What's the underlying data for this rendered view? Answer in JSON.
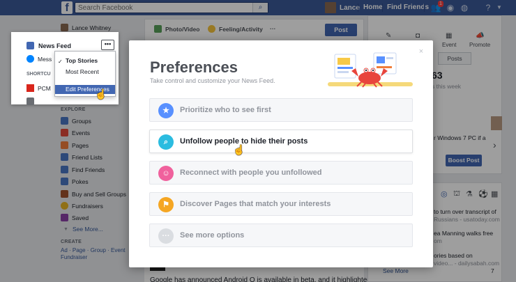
{
  "topbar": {
    "search_placeholder": "Search Facebook",
    "user_name": "Lance",
    "nav_home": "Home",
    "nav_find_friends": "Find Friends",
    "notification_count": "1"
  },
  "left_nav": {
    "user_name": "Lance Whitney",
    "explore_heading": "EXPLORE",
    "explore_items": [
      "Groups",
      "Events",
      "Pages",
      "Friend Lists",
      "Find Friends",
      "Pokes",
      "Buy and Sell Groups",
      "Fundraisers",
      "Saved"
    ],
    "see_more": "See More...",
    "create_heading": "CREATE",
    "create_links_line1": "Ad · Page · Group · Event",
    "create_links_line2": "Fundraiser"
  },
  "composer": {
    "photo_video": "Photo/Video",
    "feeling": "Feeling/Activity",
    "more": "···",
    "post": "Post"
  },
  "feed": {
    "snippet": "Google has announced Android O is available in beta, and it highlighted"
  },
  "right": {
    "tab_event": "Event",
    "tab_promote": "Promote",
    "btn_posts": "Posts",
    "stat_num": "63",
    "stat_label": "s this week",
    "post_text": "r Windows 7 PC if a",
    "boost": "Boost Post",
    "news": [
      {
        "text": "to turn over transcript of",
        "sub": "Russians - usatoday.com"
      },
      {
        "text": "ea Manning walks free",
        "sub": "om"
      },
      {
        "text": "ories based on",
        "sub": "video... - dailysabah.com"
      }
    ],
    "see_more": "See More",
    "count": "7"
  },
  "modal": {
    "title": "Preferences",
    "subtitle": "Take control and customize your News Feed.",
    "close_symbol": "×",
    "options": [
      {
        "label": "Prioritize who to see first",
        "icon": "star-icon",
        "color": "#5890ff"
      },
      {
        "label": "Unfollow people to hide their posts",
        "icon": "search-icon",
        "color": "#2bbce0"
      },
      {
        "label": "Reconnect with people you unfollowed",
        "icon": "smile-icon",
        "color": "#f0619d"
      },
      {
        "label": "Discover Pages that match your interests",
        "icon": "flag-icon",
        "color": "#f5a623"
      },
      {
        "label": "See more options",
        "icon": "more-icon",
        "color": "#dadde1"
      }
    ]
  },
  "popup": {
    "news_feed": "News Feed",
    "more": "•••",
    "messenger": "Mess",
    "shortcuts": "SHORTCU",
    "pc_mag": "PCM",
    "menu_top_stories": "Top Stories",
    "menu_most_recent": "Most Recent",
    "menu_edit_prefs": "Edit Preferences",
    "check": "✓"
  }
}
